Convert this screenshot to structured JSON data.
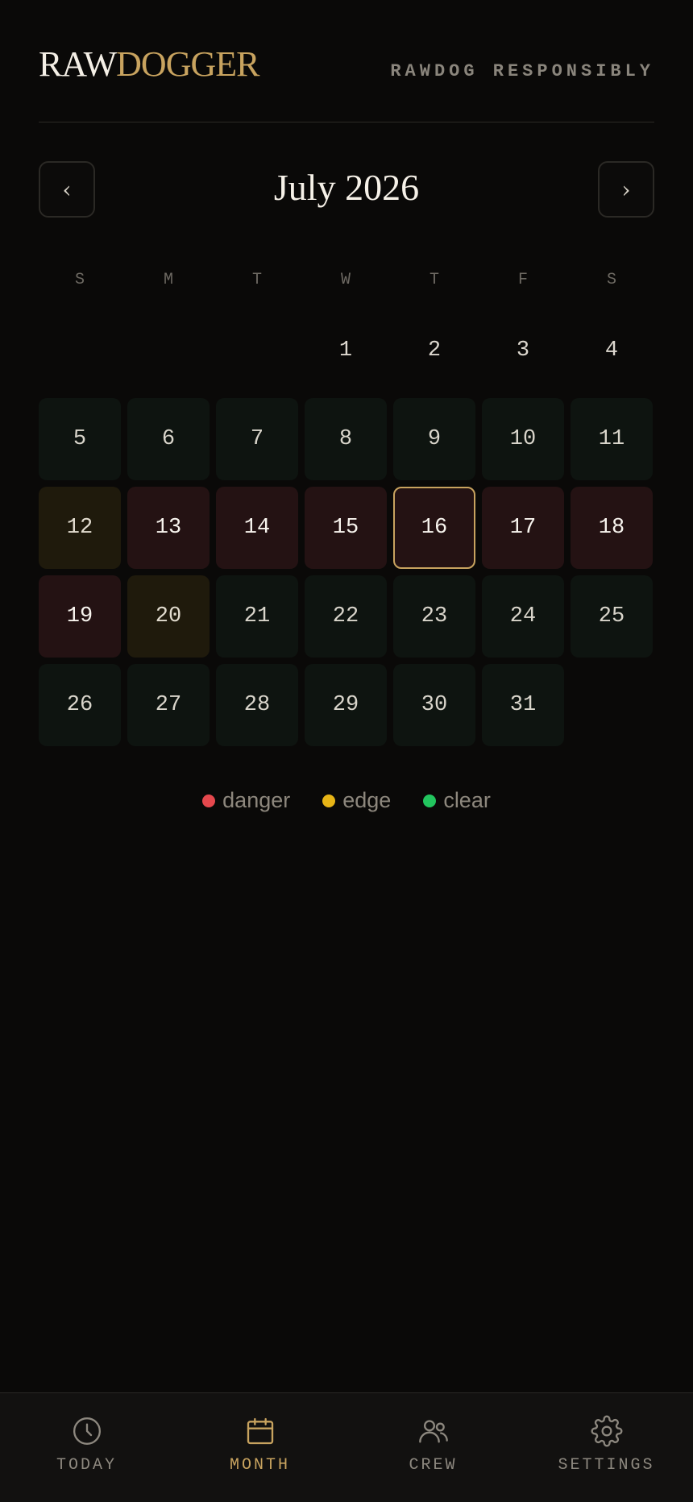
{
  "header": {
    "logo_part1": "RAW",
    "logo_part2": "DOGGER",
    "tagline": "RAWDOG RESPONSIBLY"
  },
  "calendar": {
    "prev_label": "‹",
    "next_label": "›",
    "month_title": "July 2026",
    "weekdays": [
      "S",
      "M",
      "T",
      "W",
      "T",
      "F",
      "S"
    ],
    "leading_blanks": 3,
    "days": [
      {
        "n": "1",
        "status": "none"
      },
      {
        "n": "2",
        "status": "none"
      },
      {
        "n": "3",
        "status": "none"
      },
      {
        "n": "4",
        "status": "none"
      },
      {
        "n": "5",
        "status": "clear"
      },
      {
        "n": "6",
        "status": "clear"
      },
      {
        "n": "7",
        "status": "clear"
      },
      {
        "n": "8",
        "status": "clear"
      },
      {
        "n": "9",
        "status": "clear"
      },
      {
        "n": "10",
        "status": "clear"
      },
      {
        "n": "11",
        "status": "clear"
      },
      {
        "n": "12",
        "status": "edge"
      },
      {
        "n": "13",
        "status": "danger"
      },
      {
        "n": "14",
        "status": "danger"
      },
      {
        "n": "15",
        "status": "danger"
      },
      {
        "n": "16",
        "status": "danger",
        "today": true
      },
      {
        "n": "17",
        "status": "danger"
      },
      {
        "n": "18",
        "status": "danger"
      },
      {
        "n": "19",
        "status": "danger"
      },
      {
        "n": "20",
        "status": "edge"
      },
      {
        "n": "21",
        "status": "clear"
      },
      {
        "n": "22",
        "status": "clear"
      },
      {
        "n": "23",
        "status": "clear"
      },
      {
        "n": "24",
        "status": "clear"
      },
      {
        "n": "25",
        "status": "clear"
      },
      {
        "n": "26",
        "status": "clear"
      },
      {
        "n": "27",
        "status": "clear"
      },
      {
        "n": "28",
        "status": "clear"
      },
      {
        "n": "29",
        "status": "clear"
      },
      {
        "n": "30",
        "status": "clear"
      },
      {
        "n": "31",
        "status": "clear"
      }
    ]
  },
  "legend": [
    {
      "key": "danger",
      "label": "danger",
      "color": "#e5484d"
    },
    {
      "key": "edge",
      "label": "edge",
      "color": "#e7b416"
    },
    {
      "key": "clear",
      "label": "clear",
      "color": "#22c55e"
    }
  ],
  "tabbar": [
    {
      "key": "today",
      "label": "TODAY",
      "icon": "clock-icon",
      "active": false
    },
    {
      "key": "month",
      "label": "MONTH",
      "icon": "calendar-icon",
      "active": true
    },
    {
      "key": "crew",
      "label": "CREW",
      "icon": "users-icon",
      "active": false
    },
    {
      "key": "settings",
      "label": "SETTINGS",
      "icon": "gear-icon",
      "active": false
    }
  ],
  "colors": {
    "accent": "#c8a35f",
    "background": "#0a0908"
  }
}
